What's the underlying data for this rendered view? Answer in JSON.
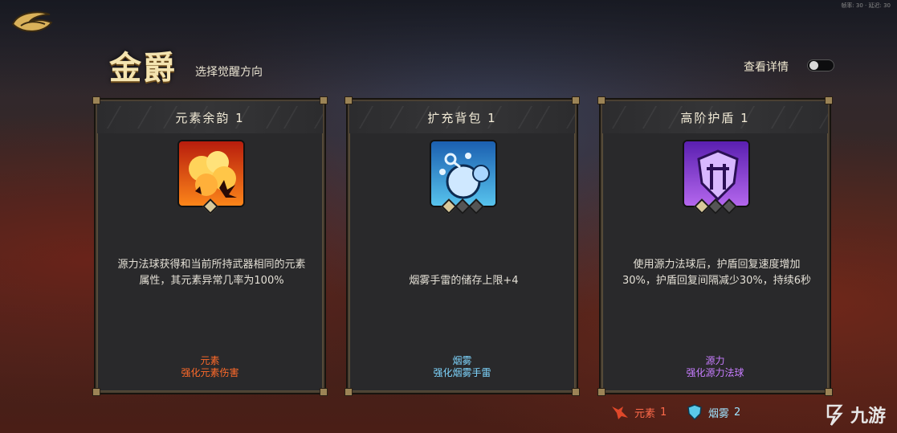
{
  "header": {
    "title": "金爵",
    "subtitle": "选择觉醒方向",
    "details_label": "查看详情",
    "top_right_text": "帧率: 30 · 延迟: 30"
  },
  "cards": [
    {
      "title": "元素余韵 1",
      "description": "源力法球获得和当前所持武器相同的元素属性，其元素异常几率为100%",
      "tag_name": "元素",
      "tag_effect": "强化元素伤害",
      "tag_color": "#ff6a2a",
      "icon": "explosion-icon",
      "pips_filled": 1,
      "pips_total": 1
    },
    {
      "title": "扩充背包 1",
      "description": "烟雾手雷的储存上限+4",
      "tag_name": "烟雾",
      "tag_effect": "强化烟雾手雷",
      "tag_color": "#7fd6ff",
      "icon": "smoke-grenade-icon",
      "pips_filled": 1,
      "pips_total": 3
    },
    {
      "title": "高阶护盾 1",
      "description": "使用源力法球后，护盾回复速度增加30%，护盾回复间隔减少30%，持续6秒",
      "tag_name": "源力",
      "tag_effect": "强化源力法球",
      "tag_color": "#c77dff",
      "icon": "shield-icon",
      "pips_filled": 1,
      "pips_total": 3
    }
  ],
  "legend": [
    {
      "label": "元素",
      "count": "1",
      "color": "#ff6a4a",
      "icon": "element-icon"
    },
    {
      "label": "烟雾",
      "count": "2",
      "color": "#9fe4ff",
      "icon": "smoke-shield-icon"
    }
  ],
  "watermark": {
    "text": "九游"
  }
}
